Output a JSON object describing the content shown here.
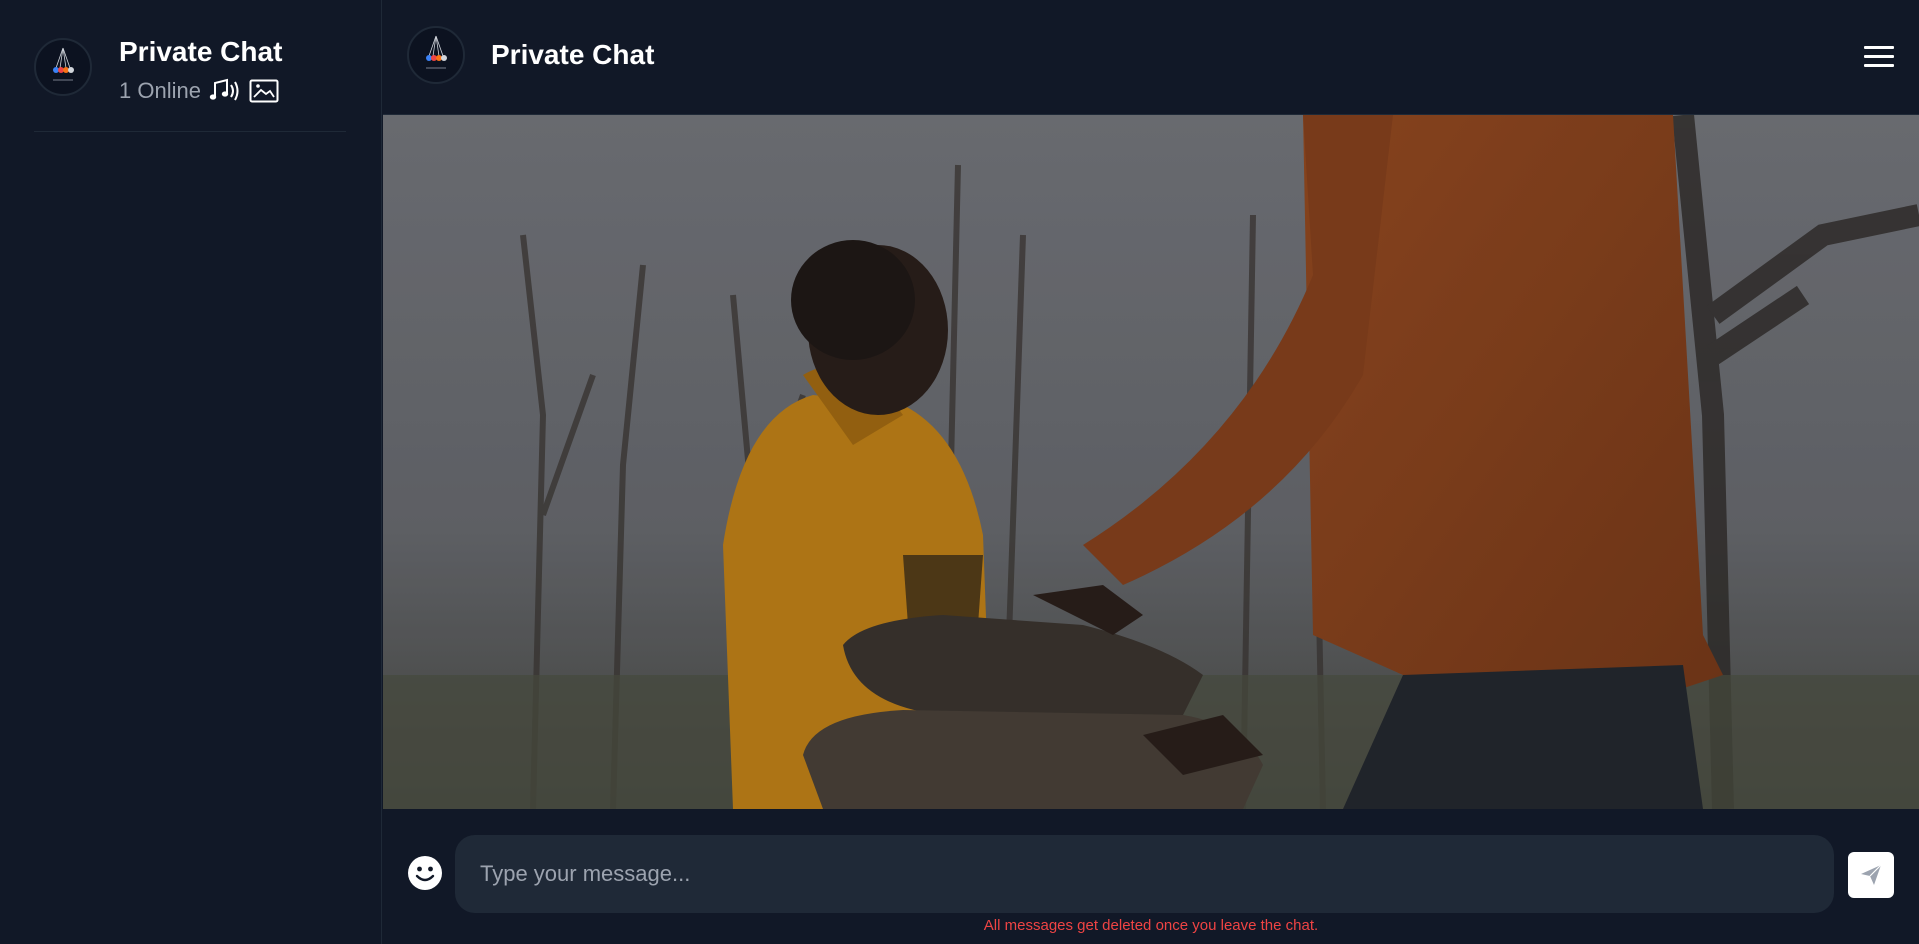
{
  "sidebar": {
    "title": "Private Chat",
    "online_status": "1 Online",
    "icons": [
      "music-notes-icon",
      "image-icon"
    ]
  },
  "chat_header": {
    "title": "Private Chat",
    "menu_icon": "hamburger-menu-icon"
  },
  "composer": {
    "placeholder": "Type your message...",
    "emoji_icon": "smiley-icon",
    "send_icon": "paper-plane-icon",
    "notice": "All messages get deleted once you leave the chat."
  },
  "colors": {
    "background": "#111827",
    "input_background": "#1f2937",
    "notice": "#ef4444"
  }
}
